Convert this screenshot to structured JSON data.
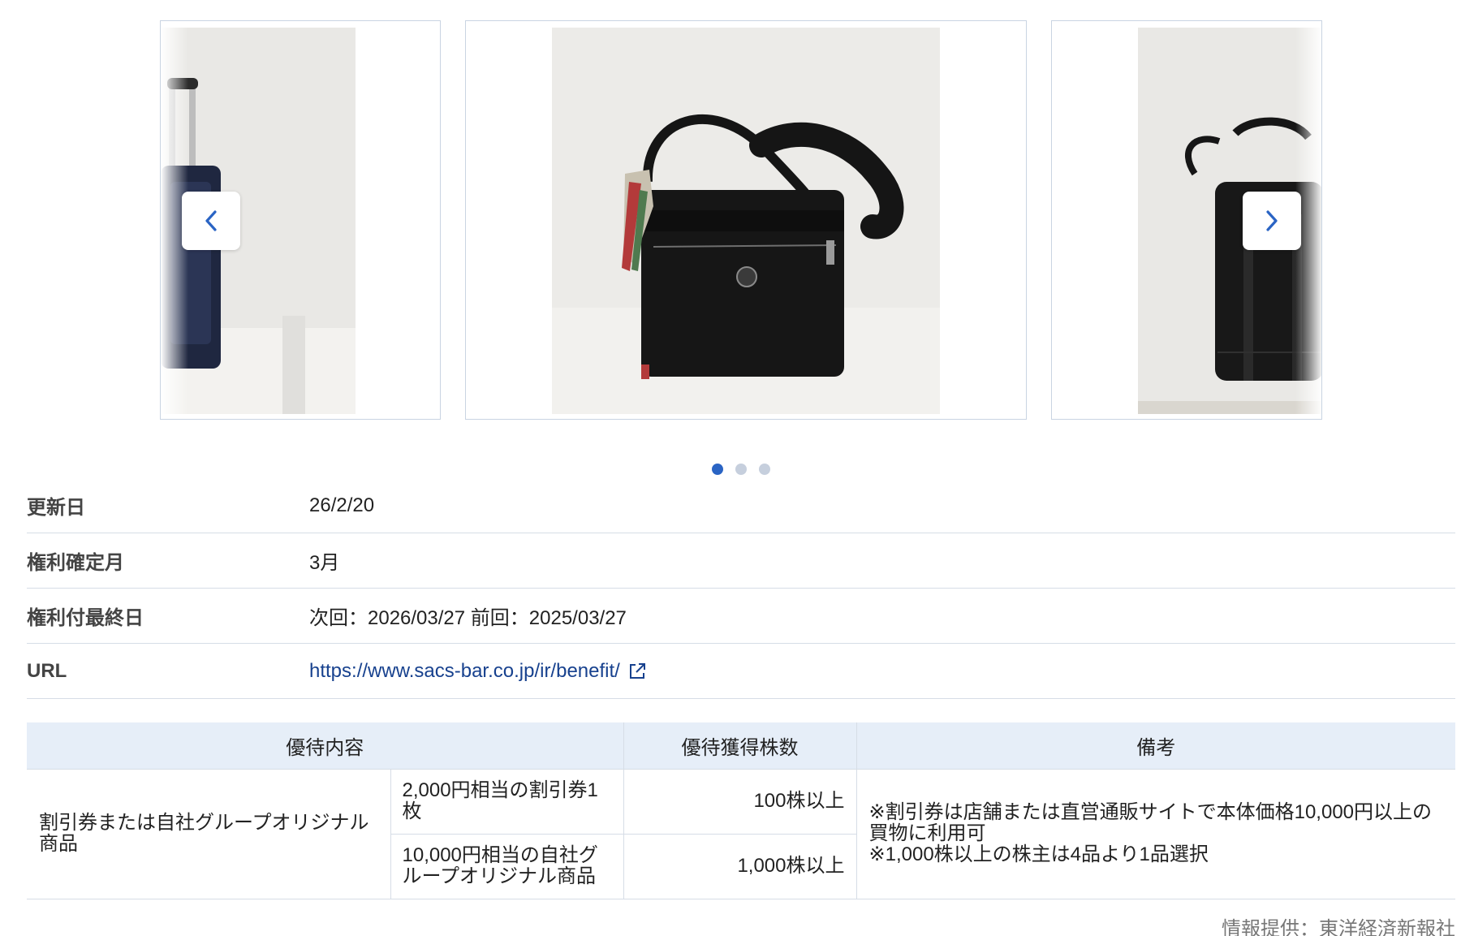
{
  "carousel": {
    "prev_icon": "chevron-left-icon",
    "next_icon": "chevron-right-icon",
    "total_slides": 3,
    "active_slide": 1,
    "accent_color": "#2a64c4"
  },
  "info": {
    "update_label": "更新日",
    "update_value": "26/2/20",
    "rights_month_label": "権利確定月",
    "rights_month_value": "3月",
    "last_day_label": "権利付最終日",
    "last_day_value": "次回：2026/03/27 前回：2025/03/27",
    "url_label": "URL",
    "url_value": "https://www.sacs-bar.co.jp/ir/benefit/",
    "url_icon": "external-link-icon"
  },
  "benefits": {
    "headers": [
      "優待内容",
      "優待獲得株数",
      "備考"
    ],
    "category": "割引券または自社グループオリジナル商品",
    "rows": [
      {
        "content": "2,000円相当の割引券1枚",
        "shares": "100株以上"
      },
      {
        "content": "10,000円相当の自社グループオリジナル商品",
        "shares": "1,000株以上"
      }
    ],
    "notes": "※割引券は店舗または直営通販サイトで本体価格10,000円以上の買物に利用可\n※1,000株以上の株主は4品より1品選択"
  },
  "source": "情報提供：東洋経済新報社"
}
